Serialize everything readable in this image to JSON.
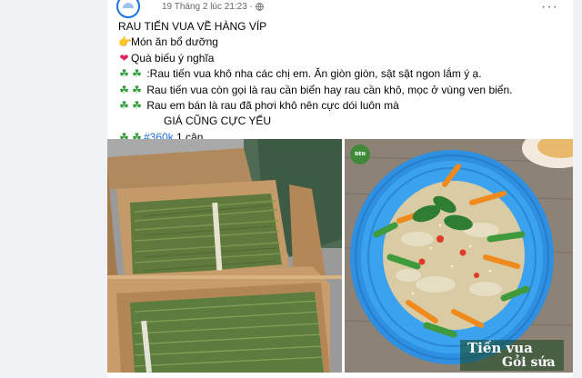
{
  "post": {
    "timestamp": "19 Tháng 2 lúc 21:23 ·",
    "more_label": "···",
    "title": "RAU TIẾN VUA VỀ HÀNG VÍP",
    "line1": "Món ăn bổ dưỡng",
    "line2": "Quà biếu ý nghĩa",
    "line3": ":Rau tiến vua khô nha các chị em. Ăn giòn giòn, sật sật ngon lắm ý ạ.",
    "line4": "Rau tiến vua còn gọi là rau cần biển hay rau cần khô, mọc ở vùng ven biển.",
    "line5": "Rau em bán là rau đã phơi khô nên cực dói luôn mà",
    "line6": "GIÁ CŨNG CỰC YẾU",
    "price_tag": "#360k",
    "price_suffix": "1 cân",
    "icons": {
      "bullet1": "pointing-hand-icon",
      "bullet2": "heart-icon",
      "clover": "four-leaf-clover-icon",
      "privacy": "globe-icon"
    }
  },
  "photos": {
    "right_badge": "ĐÈN",
    "caption_line1": "Tiến vua",
    "caption_line2": "Gỏi sứa"
  },
  "colors": {
    "hashtag": "#216fdb",
    "meta_text": "#65676b",
    "background": "#f0f2f5"
  }
}
